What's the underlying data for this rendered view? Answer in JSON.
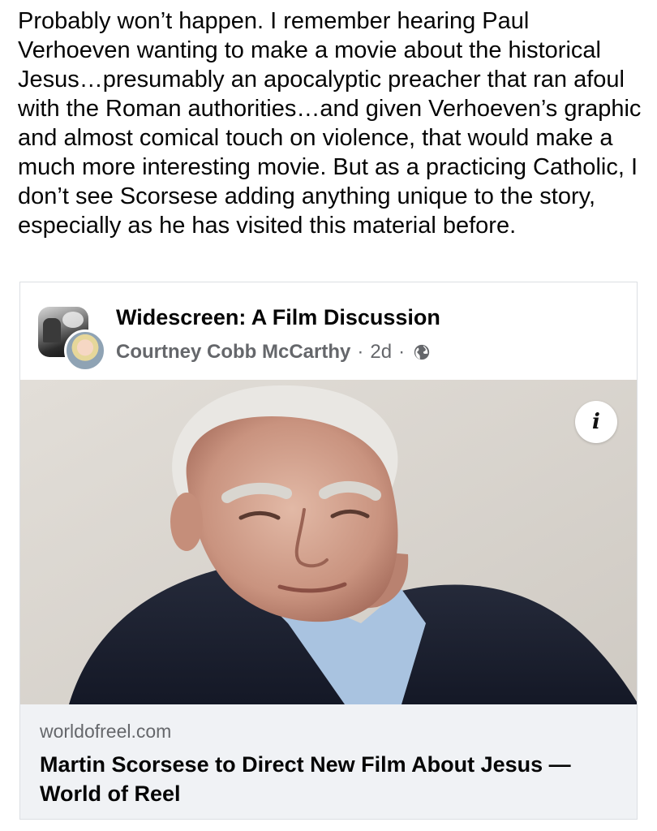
{
  "post": {
    "text": "Probably won’t happen. I remember hearing Paul Verhoeven wanting to make a movie about the historical Jesus…presumably an apocalyptic preacher that ran afoul with the Roman authorities…and given Verhoeven’s graphic and almost comical touch on violence, that would make a much more interesting movie. But as a practicing Catholic, I don’t see Scorsese adding anything unique to the story, especially as he has visited this material before."
  },
  "shared_post": {
    "group_name": "Widescreen: A Film Discussion",
    "author": "Courtney Cobb McCarthy",
    "separator": "·",
    "time": "2d",
    "audience_icon": "globe-icon",
    "info_label": "i"
  },
  "link_preview": {
    "domain": "worldofreel.com",
    "title": "Martin Scorsese to Direct New Film About Jesus — World of Reel"
  }
}
